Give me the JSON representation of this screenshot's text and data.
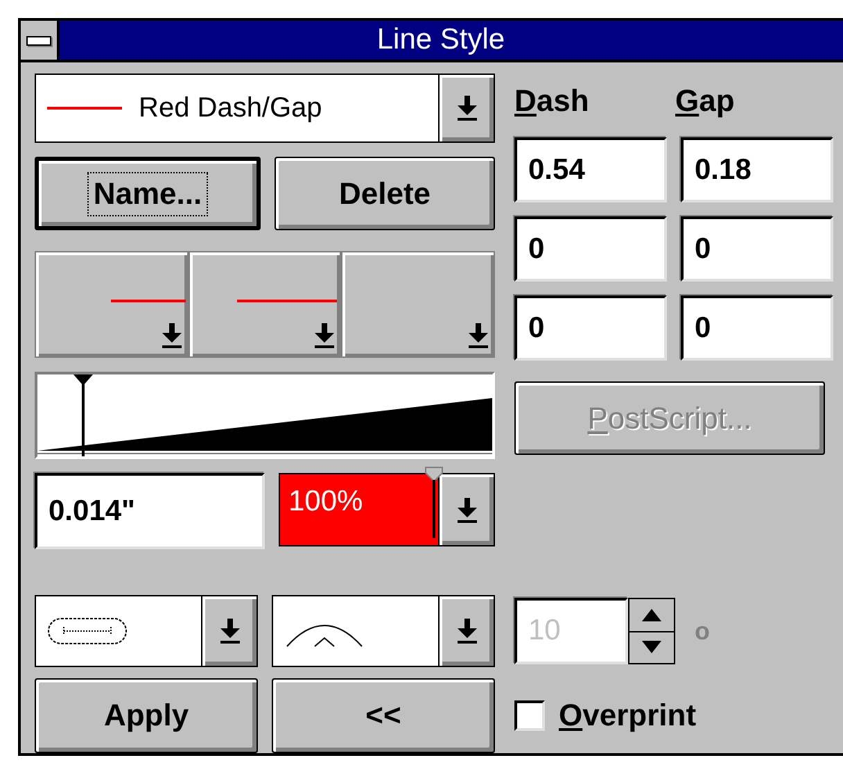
{
  "window": {
    "title": "Line Style"
  },
  "style_combo": {
    "value": "Red Dash/Gap",
    "color": "#ff0000"
  },
  "buttons_top": [
    {
      "label": "Name...",
      "focused": true
    },
    {
      "label": "Delete",
      "focused": false
    }
  ],
  "dash_header": "Dash",
  "gap_header": "Gap",
  "dash_gap_rows": [
    {
      "dash": "0.54",
      "gap": "0.18"
    },
    {
      "dash": "0",
      "gap": "0"
    },
    {
      "dash": "0",
      "gap": "0"
    }
  ],
  "taper": {
    "level": 0.1
  },
  "width_field": {
    "value": "0.014\""
  },
  "color_field": {
    "value": "100%",
    "color": "#ff0000",
    "level": 1
  },
  "postscript_button": {
    "label": "PostScript...",
    "disabled": true
  },
  "miter_spinner": {
    "value": "10",
    "unit": "o",
    "disabled": true
  },
  "overprint": {
    "label": "Overprint",
    "checked": false
  },
  "buttons_bottom": [
    {
      "label": "Apply"
    },
    {
      "label": "<<"
    }
  ]
}
